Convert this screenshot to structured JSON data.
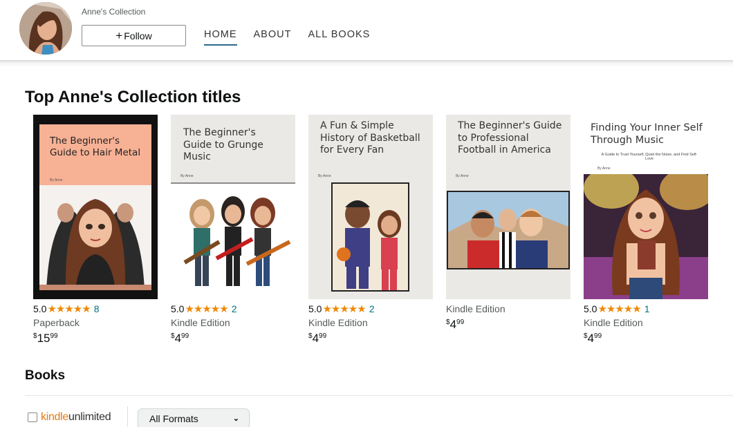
{
  "header": {
    "brand_name": "Anne's Collection",
    "follow_label": "Follow",
    "follow_icon": "plus-icon",
    "tabs": [
      {
        "label": "HOME",
        "active": true
      },
      {
        "label": "ABOUT",
        "active": false
      },
      {
        "label": "ALL BOOKS",
        "active": false
      }
    ]
  },
  "top_titles": {
    "heading": "Top Anne's Collection titles",
    "books": [
      {
        "cover_title": "The Beginner's Guide to Hair Metal",
        "byline": "By Anne",
        "rating": "5.0",
        "stars": "★★★★★",
        "review_count": "8",
        "format": "Paperback",
        "price_symbol": "$",
        "price_whole": "15",
        "price_cents": "99"
      },
      {
        "cover_title": "The Beginner's Guide to Grunge Music",
        "byline": "By Anne",
        "rating": "5.0",
        "stars": "★★★★★",
        "review_count": "2",
        "format": "Kindle Edition",
        "price_symbol": "$",
        "price_whole": "4",
        "price_cents": "99"
      },
      {
        "cover_title": "A Fun & Simple History of Basketball for Every Fan",
        "byline": "By Anne",
        "rating": "5.0",
        "stars": "★★★★★",
        "review_count": "2",
        "format": "Kindle Edition",
        "price_symbol": "$",
        "price_whole": "4",
        "price_cents": "99"
      },
      {
        "cover_title": "The Beginner's Guide to Professional Football in America",
        "byline": "By Anne",
        "rating": "",
        "stars": "",
        "review_count": "",
        "format": "Kindle Edition",
        "price_symbol": "$",
        "price_whole": "4",
        "price_cents": "99"
      },
      {
        "cover_title": "Finding Your Inner Self Through Music",
        "cover_subtitle": "A Guide to Trust Yourself, Quiet the Noise, and Find Self-Love",
        "byline": "By Anne",
        "rating": "5.0",
        "stars": "★★★★★",
        "review_count": "1",
        "format": "Kindle Edition",
        "price_symbol": "$",
        "price_whole": "4",
        "price_cents": "99"
      }
    ]
  },
  "books_section": {
    "heading": "Books",
    "kindle_unlimited_a": "kindle",
    "kindle_unlimited_b": "unlimited",
    "formats_selected": "All Formats"
  },
  "colors": {
    "accent_tab": "#2a6a8b",
    "star": "#f08804",
    "link": "#007185",
    "kindle_orange": "#e47911"
  }
}
